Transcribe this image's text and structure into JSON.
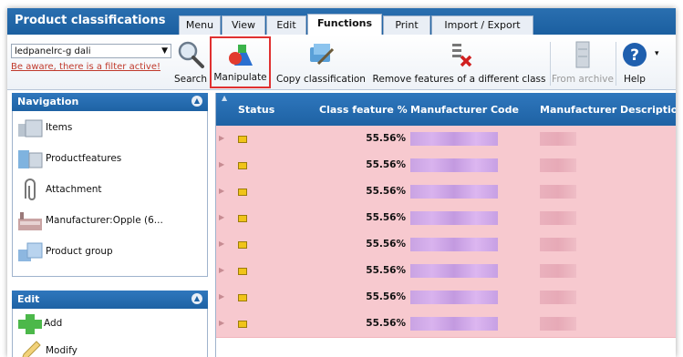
{
  "app": {
    "title": "Product classifications"
  },
  "tabs": [
    {
      "label": "Menu",
      "active": false
    },
    {
      "label": "View",
      "active": false
    },
    {
      "label": "Edit",
      "active": false
    },
    {
      "label": "Functions",
      "active": true
    },
    {
      "label": "Print",
      "active": false
    },
    {
      "label": "Import / Export",
      "active": false
    }
  ],
  "ribbon": {
    "selector_value": "ledpanelrc-g dali",
    "filter_warning": "Be aware, there is a filter active!",
    "search_label": "Search",
    "manipulate_label": "Manipulate",
    "copy_label": "Copy classification",
    "remove_label": "Remove features of a different class",
    "archive_label": "From archive",
    "help_label": "Help"
  },
  "navigation": {
    "title": "Navigation",
    "items": [
      {
        "label": "Items",
        "icon": "items-icon"
      },
      {
        "label": "Productfeatures",
        "icon": "productfeatures-icon"
      },
      {
        "label": "Attachment",
        "icon": "paperclip-icon"
      },
      {
        "label": "Manufacturer:Opple (6...",
        "icon": "factory-icon"
      },
      {
        "label": "Product group",
        "icon": "product-group-icon"
      }
    ]
  },
  "edit": {
    "title": "Edit",
    "items": [
      {
        "label": "Add",
        "icon": "plus-icon"
      },
      {
        "label": "Modify",
        "icon": "pencil-icon"
      }
    ]
  },
  "grid": {
    "columns": [
      "Status",
      "Class feature %",
      "Manufacturer Code",
      "Manufacturer Description"
    ],
    "rows": [
      {
        "pct": "55.56%"
      },
      {
        "pct": "55.56%"
      },
      {
        "pct": "55.56%"
      },
      {
        "pct": "55.56%"
      },
      {
        "pct": "55.56%"
      },
      {
        "pct": "55.56%"
      },
      {
        "pct": "55.56%"
      },
      {
        "pct": "55.56%"
      }
    ],
    "row_color": "#f7c9cf",
    "status_color": "#f0c419"
  },
  "colors": {
    "header_blue": "#1e62a4",
    "selected_outline": "#e03030",
    "warning_red": "#c0392b"
  }
}
